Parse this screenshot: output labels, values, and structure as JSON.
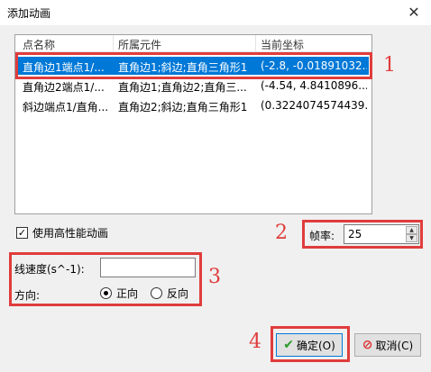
{
  "window": {
    "title": "添加动画"
  },
  "list": {
    "columns": [
      "点名称",
      "所属元件",
      "当前坐标"
    ],
    "rows": [
      [
        "直角边1端点1/...",
        "直角边1;斜边;直角三角形1",
        "(-2.8, -0.01891032..."
      ],
      [
        "直角边2端点1/...",
        "直角边1;直角边2;直角三...",
        "(-4.54, 4.8410896..."
      ],
      [
        "斜边端点1/直角...",
        "直角边2;斜边;直角三角形1",
        "(0.3224074574439..."
      ]
    ],
    "selected_index": 0
  },
  "options": {
    "high_perf_label": "使用高性能动画",
    "high_perf_checked": "✓"
  },
  "fps": {
    "label": "帧率:",
    "value": "25",
    "up": "▲",
    "down": "▼"
  },
  "speed": {
    "label": "线速度(s^-1):",
    "value": ""
  },
  "direction": {
    "label": "方向:",
    "forward": "正向",
    "reverse": "反向",
    "selected": "forward"
  },
  "buttons": {
    "ok": "确定(O)",
    "cancel": "取消(C)"
  },
  "annotations": [
    "1",
    "2",
    "3",
    "4"
  ],
  "colors": {
    "highlight": "#e03c3c",
    "selection": "#0078d7"
  }
}
